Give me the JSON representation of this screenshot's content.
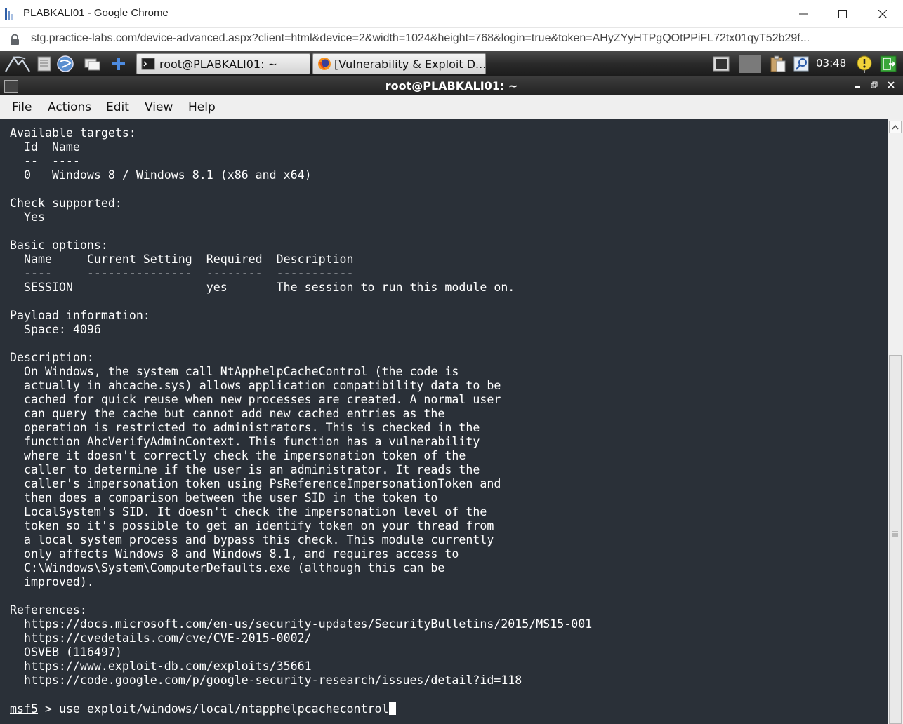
{
  "browser": {
    "window_title": "PLABKALI01 - Google Chrome",
    "url": "stg.practice-labs.com/device-advanced.aspx?client=html&device=2&width=1024&height=768&login=true&token=AHyZYyHTPgQOtPPiFL72tx01qyT52b29f..."
  },
  "kali_panel": {
    "tasks": [
      {
        "label": "root@PLABKALI01: ~",
        "icon": "terminal-icon"
      },
      {
        "label": "[Vulnerability & Exploit D...",
        "icon": "firefox-icon"
      }
    ],
    "clock": "03:48"
  },
  "terminal": {
    "title": "root@PLABKALI01: ~",
    "menu": [
      "File",
      "Actions",
      "Edit",
      "View",
      "Help"
    ],
    "lines": [
      "Available targets:",
      "  Id  Name",
      "  --  ----",
      "  0   Windows 8 / Windows 8.1 (x86 and x64)",
      "",
      "Check supported:",
      "  Yes",
      "",
      "Basic options:",
      "  Name     Current Setting  Required  Description",
      "  ----     ---------------  --------  -----------",
      "  SESSION                   yes       The session to run this module on.",
      "",
      "Payload information:",
      "  Space: 4096",
      "",
      "Description:",
      "  On Windows, the system call NtApphelpCacheControl (the code is",
      "  actually in ahcache.sys) allows application compatibility data to be",
      "  cached for quick reuse when new processes are created. A normal user",
      "  can query the cache but cannot add new cached entries as the",
      "  operation is restricted to administrators. This is checked in the",
      "  function AhcVerifyAdminContext. This function has a vulnerability",
      "  where it doesn't correctly check the impersonation token of the",
      "  caller to determine if the user is an administrator. It reads the",
      "  caller's impersonation token using PsReferenceImpersonationToken and",
      "  then does a comparison between the user SID in the token to",
      "  LocalSystem's SID. It doesn't check the impersonation level of the",
      "  token so it's possible to get an identify token on your thread from",
      "  a local system process and bypass this check. This module currently",
      "  only affects Windows 8 and Windows 8.1, and requires access to",
      "  C:\\Windows\\System\\ComputerDefaults.exe (although this can be",
      "  improved).",
      "",
      "References:",
      "  https://docs.microsoft.com/en-us/security-updates/SecurityBulletins/2015/MS15-001",
      "  https://cvedetails.com/cve/CVE-2015-0002/",
      "  OSVEB (116497)",
      "  https://www.exploit-db.com/exploits/35661",
      "  https://code.google.com/p/google-security-research/issues/detail?id=118",
      ""
    ],
    "prompt": "msf5",
    "prompt_separator": " > ",
    "command": "use exploit/windows/local/ntapphelpcachecontrol"
  },
  "colors": {
    "terminal_bg": "#2a3038",
    "terminal_fg": "#ffffff"
  }
}
